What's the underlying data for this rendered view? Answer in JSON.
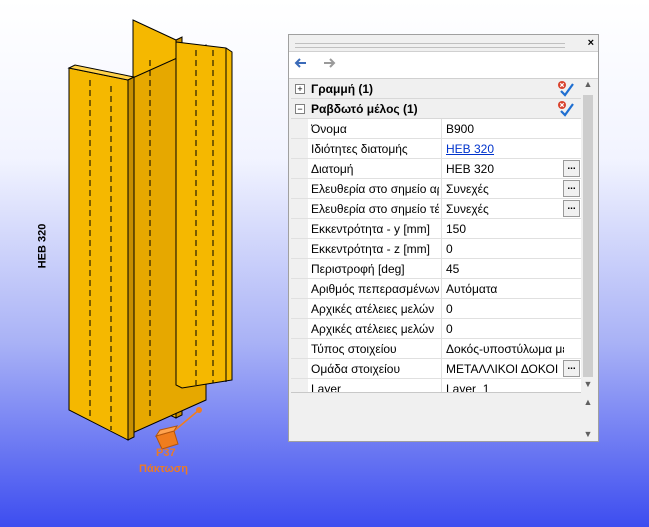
{
  "viewport": {
    "section_label": "HEB 320",
    "support_code": "P37",
    "support_name": "Πάκτωση",
    "beam_color": "#f5b800",
    "beam_dark": "#c88f00",
    "support_color": "#f07d1e"
  },
  "panel": {
    "close_label": "×",
    "nav_back_icon": "arrow-left-icon",
    "nav_forward_icon": "arrow-right-icon",
    "groups": [
      {
        "title": "Γραμμή (1)",
        "expander": "+"
      },
      {
        "title": "Ραβδωτό μέλος (1)",
        "expander": "−"
      }
    ],
    "properties": [
      {
        "name": "Όνομα",
        "value": "B900",
        "link": false,
        "button": false
      },
      {
        "name": "Ιδιότητες διατομής",
        "value": "HEB 320",
        "link": true,
        "button": false
      },
      {
        "name": "Διατομή",
        "value": "HEB 320",
        "link": false,
        "button": true
      },
      {
        "name": "Ελευθερία στο σημείο αρ",
        "value": "Συνεχές",
        "link": false,
        "button": true
      },
      {
        "name": "Ελευθερία στο σημείο τέ",
        "value": "Συνεχές",
        "link": false,
        "button": true
      },
      {
        "name": "Εκκεντρότητα - y [mm]",
        "value": "150",
        "link": false,
        "button": false
      },
      {
        "name": "Εκκεντρότητα - z [mm]",
        "value": "0",
        "link": false,
        "button": false
      },
      {
        "name": "Περιστροφή [deg]",
        "value": "45",
        "link": false,
        "button": false
      },
      {
        "name": "Αριθμός πεπερασμένων",
        "value": "Αυτόματα",
        "link": false,
        "button": false
      },
      {
        "name": "Αρχικές ατέλειες μελών",
        "value": "0",
        "link": false,
        "button": false
      },
      {
        "name": "Αρχικές ατέλειες μελών",
        "value": "0",
        "link": false,
        "button": false
      },
      {
        "name": "Τύπος στοιχείου",
        "value": "Δοκός-υποστύλωμα με",
        "link": false,
        "button": false
      },
      {
        "name": "Ομάδα στοιχείου",
        "value": "ΜΕΤΑΛΛΙΚΟΙ ΔΟΚΟΙ",
        "link": false,
        "button": true
      },
      {
        "name": "Layer",
        "value": "Layer_1",
        "link": false,
        "button": false
      }
    ],
    "button_label": "..."
  }
}
